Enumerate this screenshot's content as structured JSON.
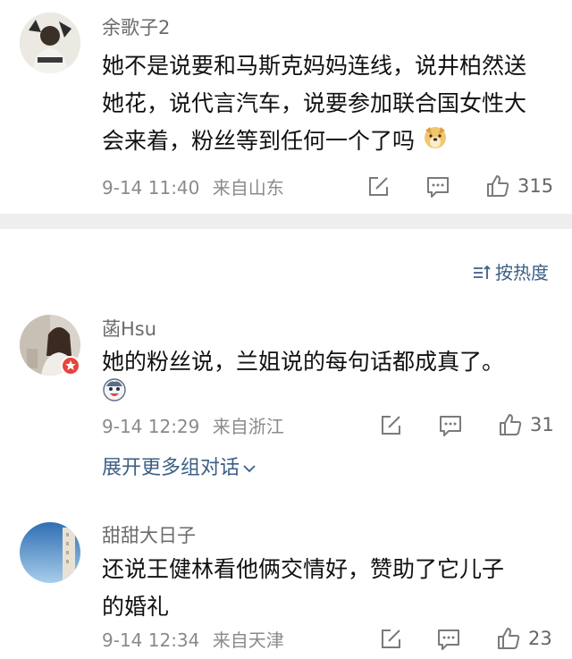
{
  "comments": [
    {
      "username": "余歌子2",
      "text_line1": "她不是说要和马斯克妈妈连线，说井柏然送",
      "text_line2": "她花，说代言汽车，说要参加联合国女性大",
      "text_line3": "会来着，粉丝等到任何一个了吗",
      "emoji": "doge-emoji",
      "date": "9-14 11:40",
      "location": "来自山东",
      "likes": "315"
    },
    {
      "username": "菡Hsu",
      "text_line1": "她的粉丝说，兰姐说的每句话都成真了。",
      "emoji": "funny-face-emoji",
      "date": "9-14 12:29",
      "location": "来自浙江",
      "likes": "31"
    },
    {
      "username": "甜甜大日子",
      "text_line1": "还说王健林看他俩交情好，赞助了它儿子",
      "text_line2": "的婚礼",
      "date": "9-14 12:34",
      "location": "来自天津",
      "likes": "23"
    }
  ],
  "sort": {
    "label": "按热度",
    "icon": "sort-icon"
  },
  "expand": {
    "label": "展开更多组对话"
  },
  "colors": {
    "link": "#3c5f86",
    "meta": "#8a8a8a",
    "divider": "#eeeeee"
  },
  "icons": [
    "share-icon",
    "comment-icon",
    "thumbs-up-icon",
    "chevron-down-icon",
    "verified-badge-icon"
  ]
}
